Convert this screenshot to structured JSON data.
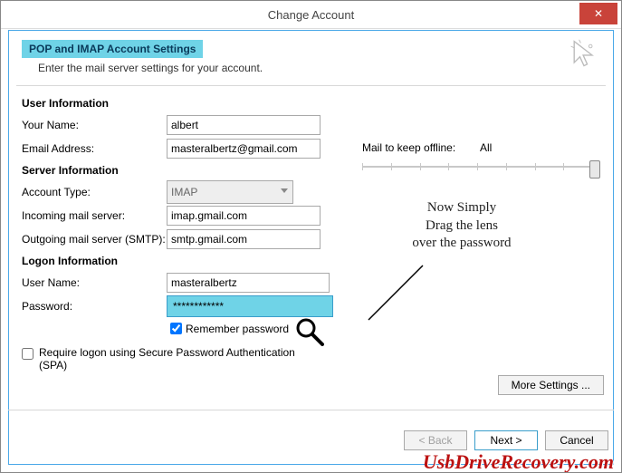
{
  "window": {
    "title": "Change Account",
    "close": "✕"
  },
  "header": {
    "banner": "POP and IMAP Account Settings",
    "subtitle": "Enter the mail server settings for your account."
  },
  "sections": {
    "user": "User Information",
    "server": "Server Information",
    "logon": "Logon Information"
  },
  "labels": {
    "name": "Your Name:",
    "email": "Email Address:",
    "acct_type": "Account Type:",
    "incoming": "Incoming mail server:",
    "outgoing": "Outgoing mail server (SMTP):",
    "username": "User Name:",
    "password": "Password:",
    "remember": "Remember password",
    "spa": "Require logon using Secure Password Authentication (SPA)",
    "mail_keep": "Mail to keep offline:",
    "mail_keep_value": "All"
  },
  "values": {
    "name": "albert",
    "email": "masteralbertz@gmail.com",
    "acct_type": "IMAP",
    "incoming": "imap.gmail.com",
    "outgoing": "smtp.gmail.com",
    "username": "masteralbertz",
    "password": "************",
    "remember_checked": true,
    "spa_checked": false
  },
  "callout": {
    "line1": "Now Simply",
    "line2": "Drag the lens",
    "line3": "over the password"
  },
  "buttons": {
    "more": "More Settings ...",
    "back": "< Back",
    "next": "Next >",
    "cancel": "Cancel"
  },
  "watermark": "UsbDriveRecovery.com",
  "colors": {
    "accent": "#6fd3e7",
    "border_blue": "#4aa8e8",
    "close_red": "#c9433a",
    "brand_red": "#b11"
  }
}
